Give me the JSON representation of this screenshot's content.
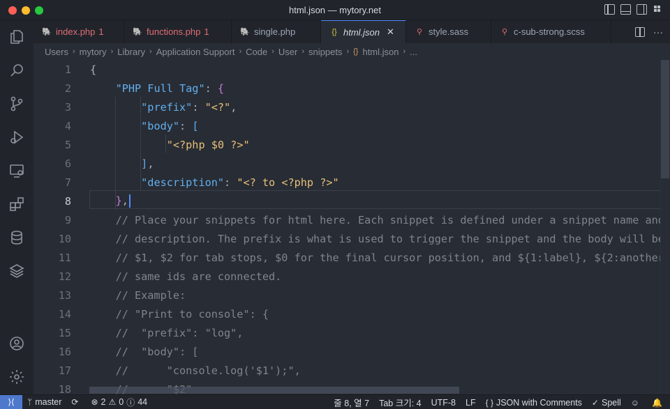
{
  "window": {
    "title": "html.json — mytory.net"
  },
  "tabs": [
    {
      "label": "index.php",
      "count": "1",
      "icon": "php-icon",
      "icon_glyph": "🐘",
      "error": true
    },
    {
      "label": "functions.php",
      "count": "1",
      "icon": "php-icon",
      "icon_glyph": "🐘",
      "error": true
    },
    {
      "label": "single.php",
      "count": "",
      "icon": "php-icon",
      "icon_glyph": "🐘",
      "error": false
    },
    {
      "label": "html.json",
      "count": "",
      "icon": "json-icon",
      "icon_glyph": "{}",
      "error": false,
      "active": true,
      "close": "✕"
    },
    {
      "label": "style.sass",
      "count": "",
      "icon": "sass-icon",
      "icon_glyph": "♂",
      "error": false
    },
    {
      "label": "c-sub-strong.scss",
      "count": "",
      "icon": "sass-icon",
      "icon_glyph": "♂",
      "error": false
    },
    {
      "label": "",
      "count": "",
      "icon": "sass-icon",
      "icon_glyph": "♂",
      "error": false
    }
  ],
  "tab_actions": {
    "more": "···"
  },
  "breadcrumb": {
    "items": [
      "Users",
      "mytory",
      "Library",
      "Application Support",
      "Code",
      "User",
      "snippets"
    ],
    "file_icon": "{}",
    "file": "html.json",
    "sep": "›",
    "tail": "..."
  },
  "editor": {
    "line_numbers": [
      "1",
      "2",
      "3",
      "4",
      "5",
      "6",
      "7",
      "8",
      "9",
      "10",
      "11",
      "12",
      "13",
      "14",
      "15",
      "16",
      "17",
      "18"
    ],
    "current_line": 8
  },
  "status": {
    "branch": "master",
    "errors": "2",
    "warnings": "0",
    "info": "0",
    "infos_count": "44",
    "position": "줄 8, 열 7",
    "tab_size": "Tab 크기: 4",
    "encoding": "UTF-8",
    "eol": "LF",
    "language": "JSON with Comments",
    "spell": "Spell"
  },
  "colors": {
    "accent": "#528bff",
    "error": "#e06c75",
    "remote": "#4d78cc"
  }
}
